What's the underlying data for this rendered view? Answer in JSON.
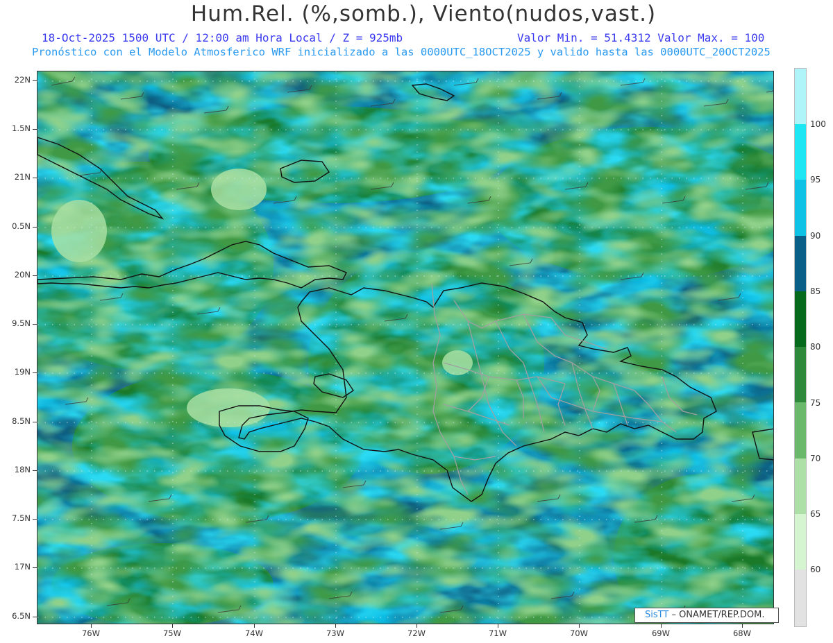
{
  "title": "Hum.Rel. (%,somb.), Viento(nudos,vast.)",
  "subtitle": {
    "line1_left": "18-Oct-2025  1500 UTC / 12:00 am Hora Local / Z = 925mb",
    "line1_right": "Valor Min. = 51.4312  Valor Max. = 100",
    "line2": "Pronóstico con el Modelo Atmosferico WRF inicializado a las 0000UTC_18OCT2025 y valido hasta las  0000UTC_20OCT2025"
  },
  "map": {
    "lat_labels": [
      "22N",
      "1.5N",
      "21N",
      "0.5N",
      "20N",
      "9.5N",
      "19N",
      "8.5N",
      "18N",
      "7.5N",
      "17N",
      "6.5N"
    ],
    "lon_labels": [
      "76W",
      "75W",
      "74W",
      "73W",
      "72W",
      "71W",
      "70W",
      "69W",
      "68W"
    ]
  },
  "colorbar": {
    "labels": [
      "100",
      "95",
      "90",
      "85",
      "80",
      "75",
      "70",
      "65",
      "60"
    ],
    "colors": [
      "#aef4f8",
      "#1ee6f2",
      "#0ec2e6",
      "#0a5f86",
      "#066a1c",
      "#2e8a3a",
      "#6ab86a",
      "#ace0a6",
      "#d4f5d0",
      "#e2e2e2"
    ]
  },
  "credit": {
    "brand": "SisTT",
    "org": "– ONAMET/REP.DOM."
  },
  "colors": {
    "title": "#333333",
    "subtitle1": "#3a3af0",
    "subtitle2": "#2a9af0",
    "coast": "#111111",
    "provinces": "#999999"
  }
}
